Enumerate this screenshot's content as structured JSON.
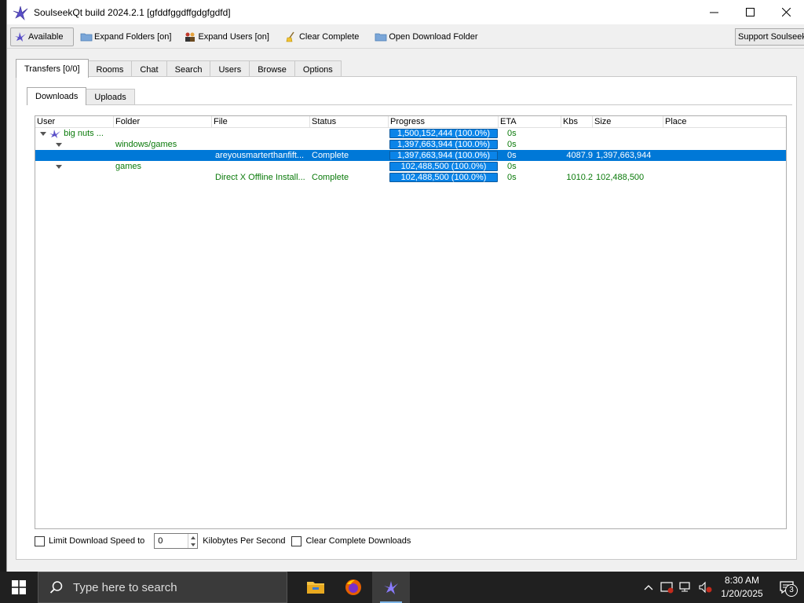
{
  "window": {
    "title": "SoulseekQt build 2024.2.1 [gfddfggdffgdgfgdfd]"
  },
  "toolbar": {
    "status_label": "Available",
    "expand_folders_label": "Expand Folders [on]",
    "expand_users_label": "Expand Users [on]",
    "clear_complete_label": "Clear Complete",
    "open_download_folder_label": "Open Download Folder",
    "support_label": "Support Soulseek"
  },
  "main_tabs": {
    "transfers": "Transfers [0/0]",
    "rooms": "Rooms",
    "chat": "Chat",
    "search": "Search",
    "users": "Users",
    "browse": "Browse",
    "options": "Options"
  },
  "sub_tabs": {
    "downloads": "Downloads",
    "uploads": "Uploads"
  },
  "columns": {
    "user": "User",
    "folder": "Folder",
    "file": "File",
    "status": "Status",
    "progress": "Progress",
    "eta": "ETA",
    "kbs": "Kbs",
    "size": "Size",
    "place": "Place"
  },
  "rows": [
    {
      "user": "big nuts ...",
      "folder": "",
      "file": "",
      "status": "",
      "progress": "1,500,152,444 (100.0%)",
      "eta": "0s",
      "kbs": "",
      "size": "",
      "place": ""
    },
    {
      "user": "",
      "folder": "windows/games",
      "file": "",
      "status": "",
      "progress": "1,397,663,944 (100.0%)",
      "eta": "0s",
      "kbs": "",
      "size": "",
      "place": ""
    },
    {
      "user": "",
      "folder": "",
      "file": "areyousmarterthanfift...",
      "status": "Complete",
      "progress": "1,397,663,944 (100.0%)",
      "eta": "0s",
      "kbs": "4087.9",
      "size": "1,397,663,944",
      "place": ""
    },
    {
      "user": "",
      "folder": "games",
      "file": "",
      "status": "",
      "progress": "102,488,500 (100.0%)",
      "eta": "0s",
      "kbs": "",
      "size": "",
      "place": ""
    },
    {
      "user": "",
      "folder": "",
      "file": "Direct X Offline Install...",
      "status": "Complete",
      "progress": "102,488,500 (100.0%)",
      "eta": "0s",
      "kbs": "1010.2",
      "size": "102,488,500",
      "place": ""
    }
  ],
  "bottom": {
    "limit_speed_label": "Limit Download Speed to",
    "speed_value": "0",
    "units_label": "Kilobytes Per Second",
    "clear_complete_downloads_label": "Clear Complete Downloads"
  },
  "taskbar": {
    "search_placeholder": "Type here to search",
    "time": "8:30 AM",
    "date": "1/20/2025",
    "notification_count": "3"
  },
  "colors": {
    "selection": "#0078d7",
    "progress_fill": "#0a84e8",
    "tree_text_green": "#0a7a0a"
  }
}
